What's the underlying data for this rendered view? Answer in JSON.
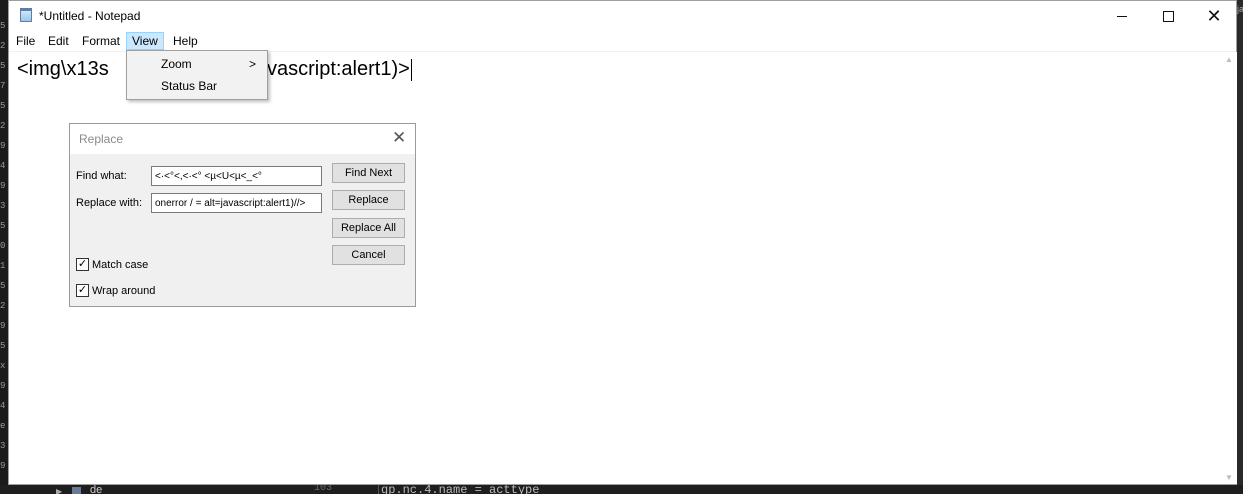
{
  "background": {
    "bottom_label": "de",
    "line_number": "103",
    "code_line": "gp.nc.4.name = acttype"
  },
  "window": {
    "title": "*Untitled - Notepad",
    "min_icon": "minimize-icon",
    "max_icon": "maximize-icon",
    "close_icon": "close-icon"
  },
  "menu": {
    "items": [
      "File",
      "Edit",
      "Format",
      "View",
      "Help"
    ],
    "active": "View"
  },
  "view_menu": {
    "items": [
      {
        "label": "Zoom",
        "submenu": true
      },
      {
        "label": "Status Bar",
        "submenu": false
      }
    ],
    "submenu_arrow": ">"
  },
  "editor": {
    "text_left": "<img\\x13s",
    "text_right": "=javascript:alert1)>"
  },
  "replace_dialog": {
    "title": "Replace",
    "close_glyph": "✕",
    "find_label": "Find what:",
    "find_value": "<·<°<,<·<° <µ<Ù<µ<_<°",
    "replace_label": "Replace with:",
    "replace_value": "onerror / = alt=javascript:alert1)//>",
    "buttons": {
      "find_next": "Find Next",
      "replace": "Replace",
      "replace_all": "Replace All",
      "cancel": "Cancel"
    },
    "match_case": {
      "label": "Match case",
      "checked": true
    },
    "wrap_around": {
      "label": "Wrap around",
      "checked": true
    }
  }
}
